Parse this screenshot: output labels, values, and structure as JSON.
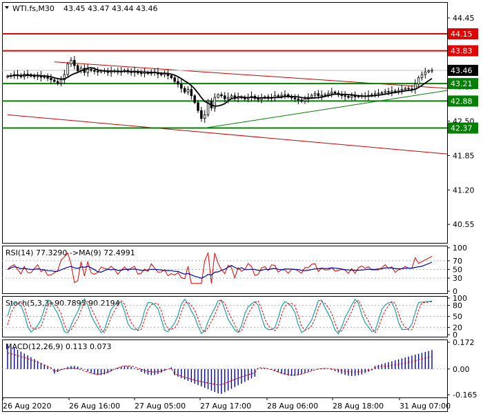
{
  "main": {
    "symbol_label": "WTI.fs,M30",
    "ohlc_label": "43.45 43.47 43.44 43.46",
    "price_ticks": [
      "44.45",
      "43.15",
      "42.50",
      "41.85",
      "41.20",
      "40.55"
    ],
    "price_tick_values": [
      44.45,
      43.8,
      43.15,
      42.5,
      41.85,
      41.2,
      40.55
    ],
    "price_tick_labels": [
      "44.45",
      "",
      "43.15",
      "42.50",
      "41.85",
      "41.20",
      "40.55"
    ],
    "levels": [
      {
        "value": 44.15,
        "label": "44.15",
        "color": "#e00000",
        "kind": "resistance"
      },
      {
        "value": 43.83,
        "label": "43.83",
        "color": "#e00000",
        "kind": "resistance"
      },
      {
        "value": 43.21,
        "label": "43.21",
        "color": "#008000",
        "kind": "support"
      },
      {
        "value": 42.88,
        "label": "42.88",
        "color": "#008000",
        "kind": "support"
      },
      {
        "value": 42.37,
        "label": "42.37",
        "color": "#008000",
        "kind": "support"
      }
    ],
    "current_price": {
      "value": 43.46,
      "label": "43.46"
    }
  },
  "rsi": {
    "label": "RSI(14) 77.3290  ->MA(9) 72.4991",
    "ticks": [
      "100",
      "70",
      "50",
      "30",
      "0"
    ]
  },
  "stoch": {
    "label": "Stoch(5,3,3) 90.7895 90.2194",
    "ticks": [
      "100",
      "80",
      "50",
      "20",
      "0"
    ]
  },
  "macd": {
    "label": "MACD(12,26,9) 0.113 0.073",
    "ticks": [
      "0.172",
      "0.00",
      "-0.165"
    ]
  },
  "time_labels": [
    "26 Aug 2020",
    "26 Aug 16:00",
    "27 Aug 05:00",
    "27 Aug 17:00",
    "28 Aug 06:00",
    "28 Aug 18:00",
    "31 Aug 07:00"
  ],
  "colors": {
    "candle": "#000000",
    "ma": "#000000",
    "resistance": "#e00000",
    "support": "#008000",
    "trend_red": "#cc0000",
    "trend_green": "#008000",
    "rsi_main": "#0000a0",
    "rsi_signal": "#e00000",
    "stoch_main": "#20a0a0",
    "stoch_signal": "#e00000",
    "macd_hist": "#0000a0",
    "macd_signal": "#e00000"
  },
  "chart_data": {
    "type": "candlestick",
    "symbol": "WTI.fs",
    "timeframe": "M30",
    "last_ohlc": {
      "open": 43.45,
      "high": 43.47,
      "low": 43.44,
      "close": 43.46
    },
    "ylim": [
      40.2,
      44.75
    ],
    "closes": [
      43.35,
      43.36,
      43.38,
      43.37,
      43.34,
      43.39,
      43.38,
      43.35,
      43.34,
      43.36,
      43.33,
      43.34,
      43.31,
      43.28,
      43.25,
      43.22,
      43.28,
      43.38,
      43.58,
      43.65,
      43.55,
      43.45,
      43.5,
      43.42,
      43.48,
      43.46,
      43.44,
      43.43,
      43.45,
      43.44,
      43.42,
      43.44,
      43.45,
      43.43,
      43.44,
      43.46,
      43.43,
      43.42,
      43.44,
      43.41,
      43.4,
      43.42,
      43.4,
      43.43,
      43.42,
      43.39,
      43.38,
      43.4,
      43.36,
      43.32,
      43.25,
      43.2,
      43.12,
      43.05,
      43.1,
      42.98,
      42.85,
      42.7,
      42.55,
      42.62,
      42.88,
      42.75,
      42.95,
      43.0,
      42.98,
      42.92,
      42.95,
      42.98,
      42.93,
      42.96,
      42.94,
      42.92,
      42.95,
      42.97,
      42.93,
      42.91,
      42.94,
      42.96,
      42.93,
      42.95,
      42.98,
      42.97,
      42.99,
      43.0,
      42.96,
      42.94,
      42.92,
      42.9,
      42.88,
      42.92,
      42.95,
      42.99,
      43.02,
      42.98,
      42.99,
      43.0,
      43.02,
      43.05,
      43.03,
      43.0,
      42.98,
      42.97,
      42.95,
      42.98,
      42.96,
      42.97,
      42.98,
      42.97,
      42.99,
      43.0,
      43.02,
      43.03,
      43.04,
      43.06,
      43.05,
      43.07,
      43.06,
      43.08,
      43.1,
      43.12,
      43.11,
      43.1,
      43.2,
      43.32,
      43.38,
      43.43,
      43.45,
      43.46
    ],
    "support_levels": [
      43.21,
      42.88,
      42.37
    ],
    "resistance_levels": [
      44.15,
      43.83
    ],
    "rsi": {
      "value": 77.329,
      "ma": 72.4991,
      "levels": [
        70,
        50,
        30
      ]
    },
    "stochastic": {
      "k": 90.7895,
      "d": 90.2194,
      "levels": [
        80,
        50,
        20
      ]
    },
    "macd": {
      "value": 0.113,
      "signal": 0.073,
      "ylim": [
        -0.165,
        0.172
      ]
    }
  }
}
